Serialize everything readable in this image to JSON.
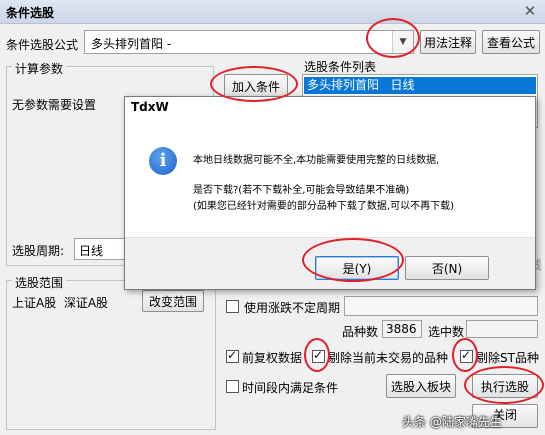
{
  "window": {
    "title": "条件选股"
  },
  "formula": {
    "label": "条件选股公式",
    "value": "多头排列首阳 -",
    "usage_btn": "用法注释",
    "view_btn": "查看公式"
  },
  "params": {
    "group_title": "计算参数",
    "none_text": "无参数需要设置"
  },
  "add_condition_btn": "加入条件",
  "condition_list": {
    "title": "选股条件列表",
    "items": [
      "多头排列首阳   日线"
    ]
  },
  "period": {
    "label": "选股周期:",
    "value": "日线"
  },
  "scope": {
    "group_title": "选股范围",
    "markets": "上证A股  深证A股",
    "change_btn": "改变范围"
  },
  "options": {
    "limit_label": "使用涨跌不定周期",
    "count_label": "品种数",
    "count_value": "3886",
    "selected_label": "选中数",
    "restore_label": "前复权数据",
    "exclude_untraded_label": "剔除当前未交易的品种",
    "exclude_st_label": "剔除ST品种",
    "period_satisfy_label": "时间段内满足条件",
    "to_block_btn": "选股入板块",
    "execute_btn": "执行选股",
    "close_btn_partial": "关闭",
    "hidden_label": "日线"
  },
  "dialog": {
    "title": "TdxW",
    "line1": "本地日线数据可能不全,本功能需要使用完整的日线数据,",
    "line2": "是否下载?(若不下载补全,可能会导致结果不准确)",
    "line3": "(如果您已经针对需要的部分品种下载了数据,可以不再下载)",
    "yes_btn": "是(Y)",
    "no_btn": "否(N)"
  },
  "watermark": "头条 @陆家嘴先生",
  "colors": {
    "selection": "#0a78d7",
    "ring": "#e0202a",
    "info_icon": "#1a63c8"
  }
}
